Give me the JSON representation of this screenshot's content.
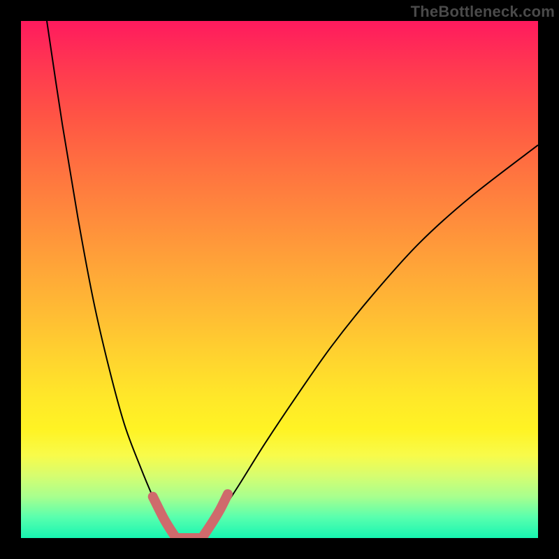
{
  "watermark": "TheBottleneck.com",
  "colors": {
    "frame_bg_top": "#ff1a5e",
    "frame_bg_bottom": "#17f5b1",
    "page_bg": "#000000",
    "curve": "#000000",
    "highlight": "#cf6a6c"
  },
  "chart_data": {
    "type": "line",
    "title": "",
    "xlabel": "",
    "ylabel": "",
    "xlim": [
      0,
      100
    ],
    "ylim": [
      0,
      100
    ],
    "grid": false,
    "legend": false,
    "series": [
      {
        "name": "left-branch",
        "x": [
          5,
          8,
          11,
          14,
          17,
          20,
          23,
          25.5,
          27.5,
          29,
          30
        ],
        "y": [
          100,
          80,
          62,
          46,
          33,
          22,
          14,
          8,
          4,
          1.5,
          0
        ]
      },
      {
        "name": "valley-floor",
        "x": [
          30,
          31,
          32,
          33,
          34,
          35
        ],
        "y": [
          0,
          0,
          0,
          0,
          0,
          0
        ]
      },
      {
        "name": "right-branch",
        "x": [
          35,
          38,
          42,
          47,
          53,
          60,
          68,
          77,
          87,
          100
        ],
        "y": [
          0,
          4,
          10,
          18,
          27,
          37,
          47,
          57,
          66,
          76
        ]
      }
    ],
    "annotations": [
      {
        "name": "highlight-left",
        "x": [
          25.5,
          27.5,
          29,
          30
        ],
        "y": [
          8,
          4,
          1.5,
          0
        ]
      },
      {
        "name": "highlight-floor",
        "x": [
          30,
          31,
          32,
          33,
          34,
          35
        ],
        "y": [
          0,
          0,
          0,
          0,
          0,
          0
        ]
      },
      {
        "name": "highlight-right",
        "x": [
          35,
          37,
          38.5,
          40
        ],
        "y": [
          0,
          3,
          5.5,
          8.5
        ]
      }
    ]
  }
}
